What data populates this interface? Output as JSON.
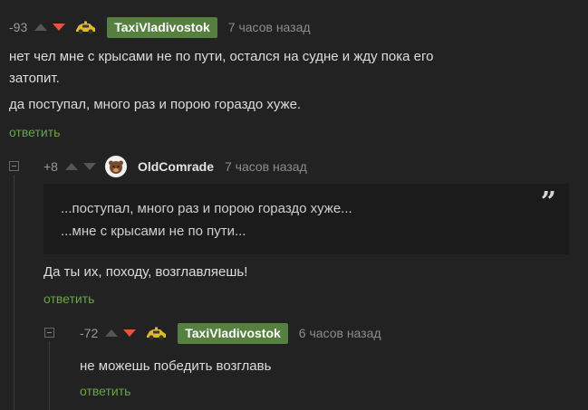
{
  "comments": [
    {
      "rating": "-93",
      "author": "TaxiVladivostok",
      "time": "7 часов назад",
      "lines": [
        "нет чел мне с крысами не по пути,  остался на судне и жду пока его",
        "затопит.",
        "да поступал, много раз и порою гораздо хуже."
      ],
      "reply_label": "ответить"
    },
    {
      "rating": "+8",
      "author": "OldComrade",
      "time": "7 часов назад",
      "quote_lines": [
        "...поступал, много раз и порою гораздо хуже...",
        "...мне с крысами не по пути..."
      ],
      "quote_icon": "quote-icon",
      "text": "Да ты их, походу, возглавляешь!",
      "reply_label": "ответить"
    },
    {
      "rating": "-72",
      "author": "TaxiVladivostok",
      "time": "6 часов назад",
      "text": "не можешь победить возглавь",
      "reply_label": "ответить"
    }
  ],
  "colors": {
    "background": "#222222",
    "author_badge": "#56803f",
    "reply_link": "#6ba34c",
    "downvote_active": "#e4543e",
    "quote_background": "#1b1b1b"
  },
  "icons": {
    "vote_up": "arrow-up-icon",
    "vote_down": "arrow-down-icon",
    "collapse": "collapse-minus-icon"
  }
}
